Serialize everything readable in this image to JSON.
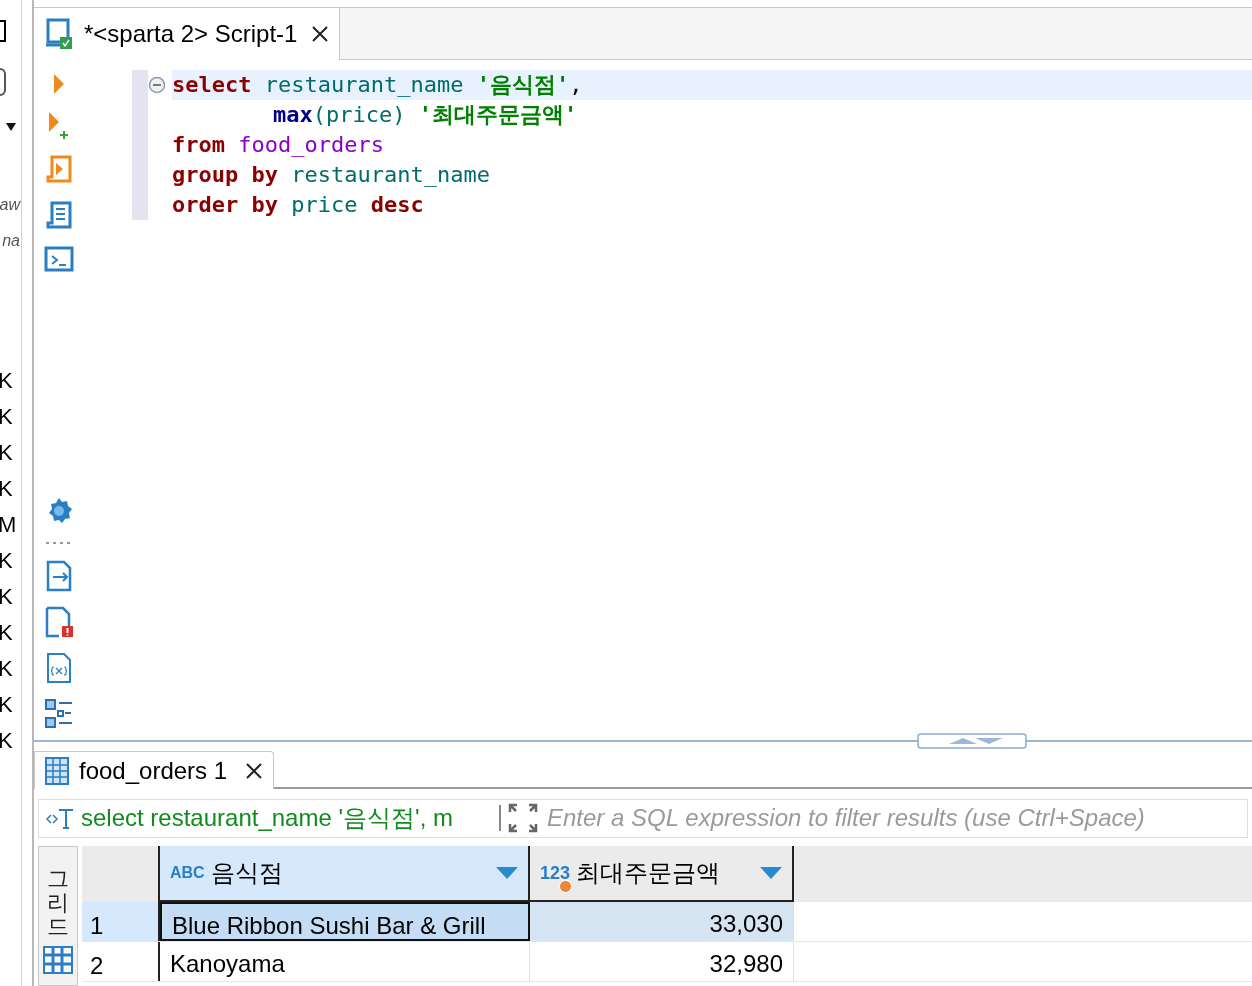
{
  "left_panel": {
    "fragments": [
      "aw",
      "na"
    ],
    "letters": [
      "K",
      "K",
      "K",
      "K",
      "M",
      "K",
      "K",
      "K",
      "K",
      "K",
      "K"
    ]
  },
  "editor": {
    "tab": {
      "title": "*<sparta 2> Script-1",
      "selected": true
    },
    "lines": [
      {
        "current": true,
        "indented": false,
        "foldable": true,
        "tokens": [
          {
            "text": "select",
            "kind": "keyword"
          },
          {
            "text": " restaurant_name ",
            "kind": "identifier"
          },
          {
            "text": "'음식점'",
            "kind": "string"
          },
          {
            "text": ",",
            "kind": "plain"
          }
        ]
      },
      {
        "current": false,
        "indented": true,
        "foldable": false,
        "tokens": [
          {
            "text": "max",
            "kind": "function"
          },
          {
            "text": "(price) ",
            "kind": "identifier"
          },
          {
            "text": "'최대주문금액'",
            "kind": "string"
          }
        ]
      },
      {
        "current": false,
        "indented": false,
        "foldable": false,
        "tokens": [
          {
            "text": "from",
            "kind": "keyword"
          },
          {
            "text": " food_orders",
            "kind": "table"
          }
        ]
      },
      {
        "current": false,
        "indented": false,
        "foldable": false,
        "tokens": [
          {
            "text": "group by",
            "kind": "keyword"
          },
          {
            "text": " restaurant_name",
            "kind": "identifier"
          }
        ]
      },
      {
        "current": false,
        "indented": false,
        "foldable": false,
        "tokens": [
          {
            "text": "order by",
            "kind": "keyword"
          },
          {
            "text": " price ",
            "kind": "identifier"
          },
          {
            "text": "desc",
            "kind": "keyword"
          }
        ]
      }
    ]
  },
  "results": {
    "tab": {
      "title": "food_orders 1",
      "selected": true
    },
    "filter": {
      "query": "select restaurant_name '음식점', m",
      "placeholder": "Enter a SQL expression to filter results (use Ctrl+Space)"
    },
    "side_tab": "그리드",
    "columns": [
      {
        "name": "음식점",
        "kind": "text",
        "type_badge": "ABC",
        "selected": true
      },
      {
        "name": "최대주문금액",
        "kind": "number",
        "type_badge": "123",
        "selected": false
      }
    ],
    "rows": [
      {
        "number": "1",
        "cells": [
          "Blue Ribbon Sushi Bar & Grill",
          "33,030"
        ],
        "selected": true
      },
      {
        "number": "2",
        "cells": [
          "Kanoyama",
          "32,980"
        ],
        "selected": false
      }
    ]
  }
}
